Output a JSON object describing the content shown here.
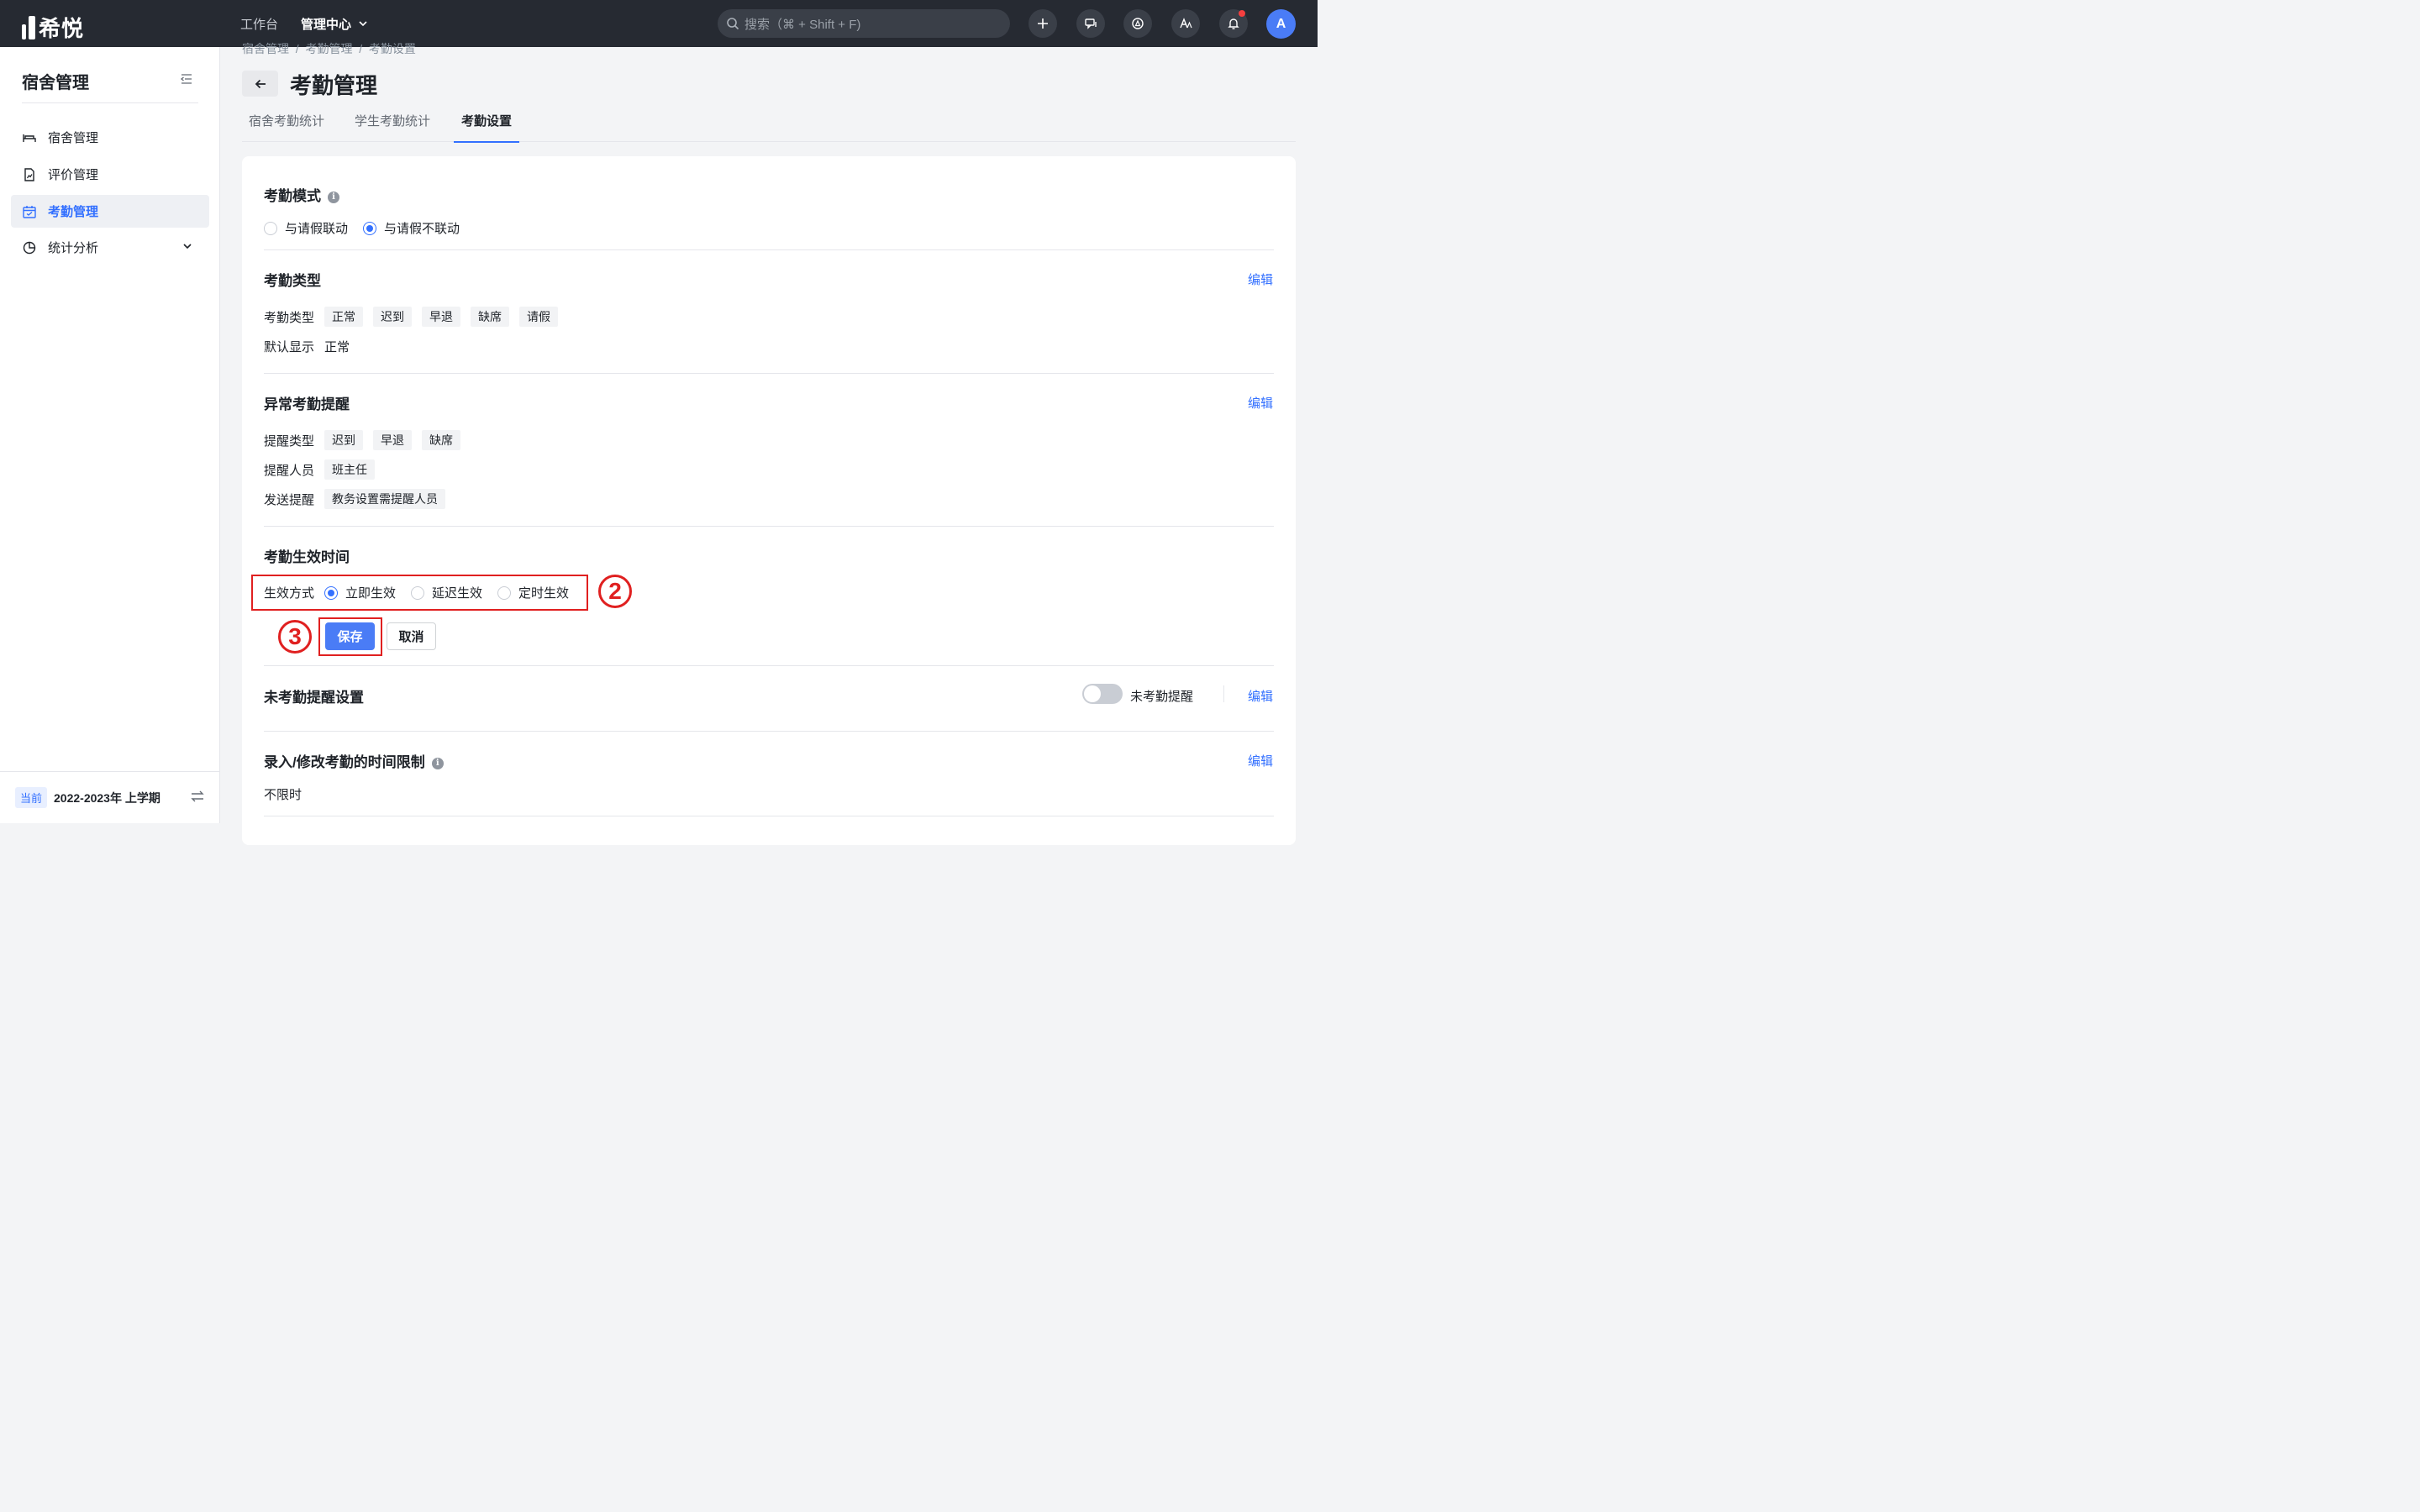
{
  "app": {
    "logo_text": "希悦"
  },
  "topnav": {
    "workbench": "工作台",
    "admin_center": "管理中心"
  },
  "search": {
    "placeholder": "搜索（⌘ + Shift + F)"
  },
  "user": {
    "avatar_letter": "A"
  },
  "sidebar": {
    "title": "宿舍管理",
    "items": [
      {
        "label": "宿舍管理",
        "icon": "bed-icon"
      },
      {
        "label": "评价管理",
        "icon": "document-chart-icon"
      },
      {
        "label": "考勤管理",
        "icon": "calendar-check-icon",
        "active": true
      },
      {
        "label": "统计分析",
        "icon": "pie-chart-icon"
      }
    ],
    "term_badge": "当前",
    "term_text": "2022-2023年 上学期"
  },
  "breadcrumb": [
    "宿舍管理",
    "考勤管理",
    "考勤设置"
  ],
  "page": {
    "title": "考勤管理"
  },
  "tabs": [
    "宿舍考勤统计",
    "学生考勤统计",
    "考勤设置"
  ],
  "sections": {
    "mode": {
      "title": "考勤模式",
      "options": [
        "与请假联动",
        "与请假不联动"
      ],
      "selected": "与请假不联动"
    },
    "type": {
      "title": "考勤类型",
      "edit": "编辑",
      "type_label": "考勤类型",
      "types": [
        "正常",
        "迟到",
        "早退",
        "缺席",
        "请假"
      ],
      "default_label": "默认显示",
      "default_value": "正常"
    },
    "alert": {
      "title": "异常考勤提醒",
      "edit": "编辑",
      "type_label": "提醒类型",
      "types": [
        "迟到",
        "早退",
        "缺席"
      ],
      "people_label": "提醒人员",
      "people": [
        "班主任"
      ],
      "send_label": "发送提醒",
      "send": [
        "教务设置需提醒人员"
      ]
    },
    "effective": {
      "title": "考勤生效时间",
      "method_label": "生效方式",
      "options": [
        "立即生效",
        "延迟生效",
        "定时生效"
      ],
      "selected": "立即生效",
      "save": "保存",
      "cancel": "取消",
      "annotation_2": "2",
      "annotation_3": "3"
    },
    "absent": {
      "title": "未考勤提醒设置",
      "toggle_label": "未考勤提醒",
      "toggle_on": false,
      "edit": "编辑"
    },
    "limit": {
      "title": "录入/修改考勤的时间限制",
      "edit": "编辑",
      "value": "不限时"
    }
  },
  "colors": {
    "accent": "#3370ff",
    "annotation": "#e02020",
    "topbar": "#262a32"
  }
}
